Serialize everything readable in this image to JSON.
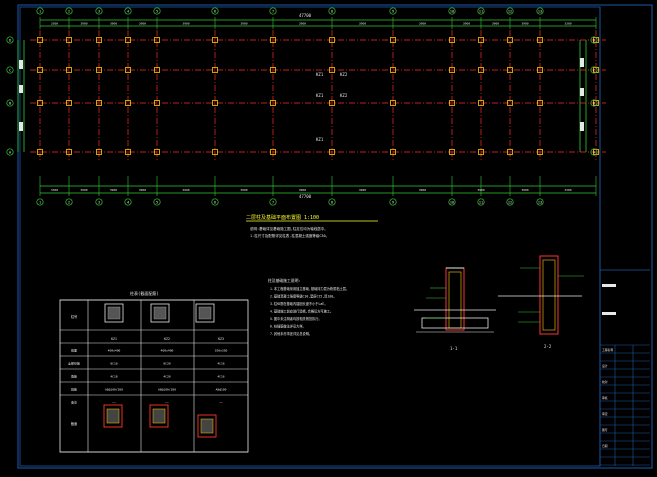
{
  "sheet": {
    "background": "#000000",
    "line_color": "#33cc33",
    "grid_color": "#ff2a2a",
    "column_color": "#ffcc00",
    "text_color": "#e8e8e8",
    "frame_color": "#1e5aa8"
  },
  "plan": {
    "axis_bubbles_x": [
      "1",
      "2",
      "3",
      "4",
      "5",
      "6",
      "7",
      "8",
      "9",
      "10",
      "11",
      "12",
      "13"
    ],
    "axis_bubbles_y": [
      "D",
      "C",
      "B",
      "A"
    ],
    "top_dims": [
      "3300",
      "3900",
      "3900",
      "3900",
      "3900",
      "3900",
      "3900",
      "3900",
      "3900",
      "3900",
      "3900",
      "3900",
      "3300"
    ],
    "top_total": "47700",
    "bottom_dims": [
      "3300",
      "3900",
      "3900",
      "3900",
      "3900",
      "3900",
      "3900",
      "3900",
      "3900",
      "3900",
      "3900",
      "3300"
    ],
    "bottom_total": "47700",
    "side_dims": [
      "2700",
      "2100",
      "2700"
    ],
    "column_tags": [
      "KZ1",
      "KZ2",
      "KZ1",
      "KZ2",
      "KZ1"
    ]
  },
  "title_block": {
    "title": "二层柱及基础平面布置图  1:100",
    "note1": "说明:基础详见基础施工图,柱定位均为轴线居中。",
    "note2": "1.柱尺寸及配筋详见柱表,柱混凝土强度等级C30。"
  },
  "column_table": {
    "caption": "柱表(截面配筋)",
    "headers": [
      "柱号",
      "KZ1",
      "KZ2",
      "KZ3"
    ],
    "rows": [
      [
        "截面",
        "400x400",
        "400x400",
        "350x350"
      ],
      [
        "全部纵筋",
        "8C18",
        "8C20",
        "4C16"
      ],
      [
        "角筋",
        "4C18",
        "4C20",
        "4C16"
      ],
      [
        "箍筋",
        "A8@100/200",
        "A8@100/200",
        "A8@100"
      ],
      [
        "备注",
        "——",
        "——",
        "——"
      ]
    ],
    "section_label": "截面"
  },
  "notes": {
    "title": "柱及基础施工说明:",
    "lines": [
      "1.本工程基础采用独立基础,基础持力层为粉质粘土层。",
      "2.基础混凝土强度等级C30,垫层C15,厚100。",
      "3.柱纵筋在基础内锚固长度不小于LaE。",
      "4.基础施工前应进行验槽,合格后方可施工。",
      "5.图中未注明者均按相关规范执行。",
      "6.柱插筋做法详见大样。",
      "7.其他未尽事宜详见总说明。"
    ]
  },
  "details": {
    "detail1_label": "1-1",
    "detail2_label": "2-2"
  },
  "title_block_right": {
    "rows": [
      "工程名称",
      "设计",
      "校对",
      "审核",
      "审定",
      "图号",
      "日期"
    ]
  }
}
